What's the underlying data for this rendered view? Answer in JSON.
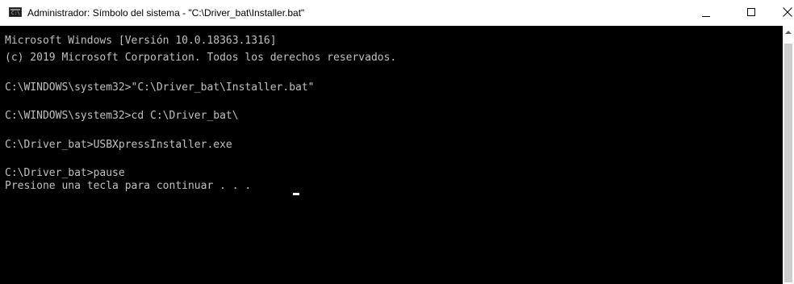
{
  "window": {
    "title": "Administrador: Símbolo del sistema - \"C:\\Driver_bat\\Installer.bat\"",
    "app_icon_text": "C:\\",
    "controls": {
      "minimize_icon": "minimize-icon",
      "maximize_icon": "maximize-icon",
      "close_icon": "close-icon"
    }
  },
  "console": {
    "text_color": "#c0c0c0",
    "background": "#000000",
    "lines": [
      "Microsoft Windows [Versión 10.0.18363.1316]",
      "(c) 2019 Microsoft Corporation. Todos los derechos reservados.",
      "",
      "C:\\WINDOWS\\system32>\"C:\\Driver_bat\\Installer.bat\"",
      "",
      "C:\\WINDOWS\\system32>cd C:\\Driver_bat\\",
      "",
      "C:\\Driver_bat>USBXpressInstaller.exe",
      "",
      "C:\\Driver_bat>pause",
      "Presione una tecla para continuar . . . "
    ]
  }
}
